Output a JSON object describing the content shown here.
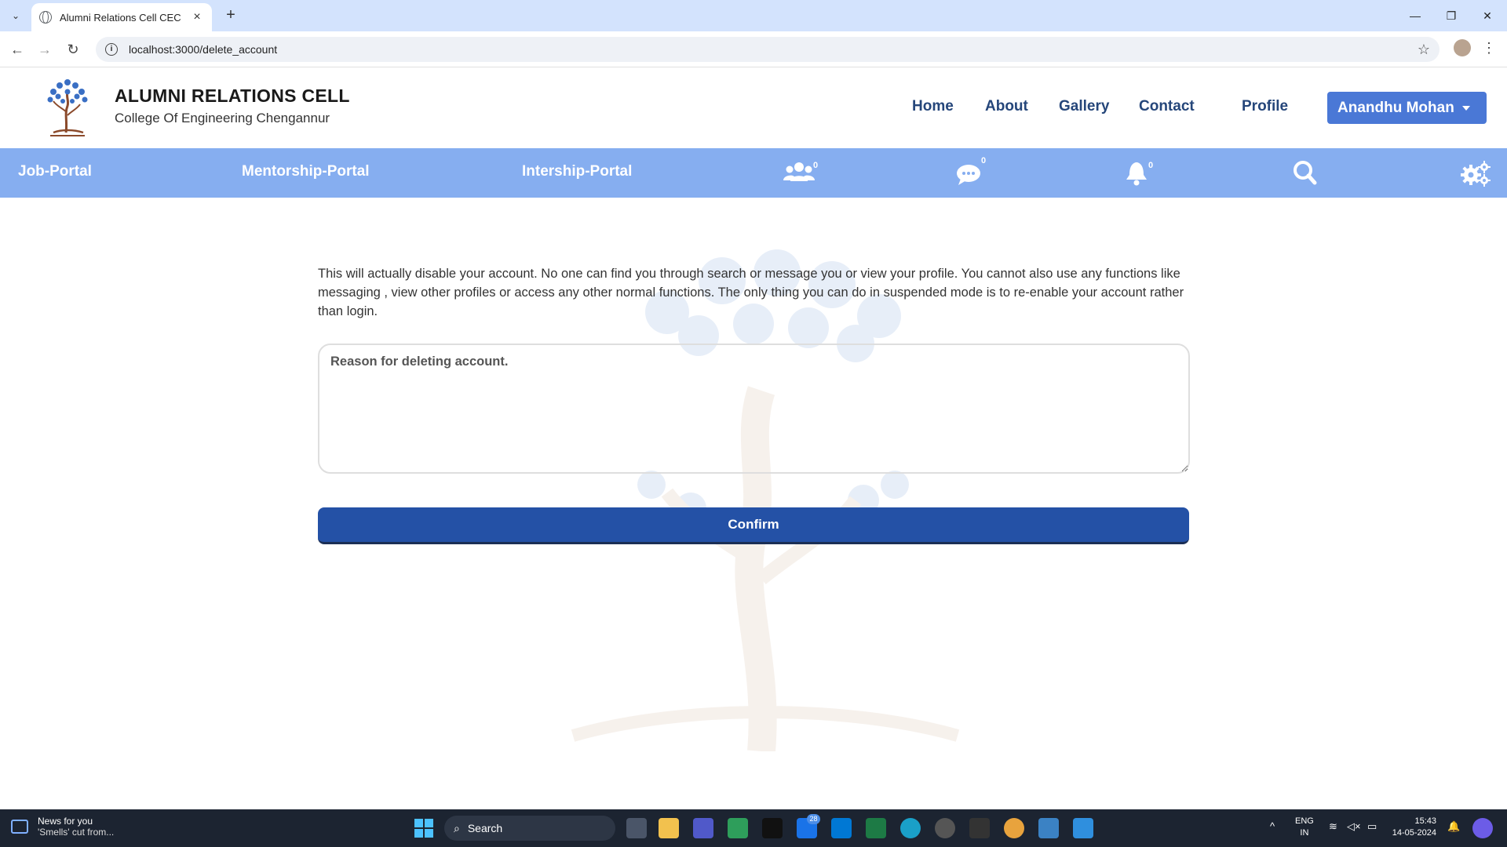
{
  "browser": {
    "tab_title": "Alumni Relations Cell CEC",
    "url": "localhost:3000/delete_account"
  },
  "header": {
    "brand_title": "ALUMNI RELATIONS CELL",
    "brand_subtitle": "College Of Engineering Chengannur",
    "nav": [
      "Home",
      "About",
      "Gallery",
      "Contact",
      "Profile"
    ],
    "user_name": "Anandhu Mohan"
  },
  "subnav": {
    "links": [
      "Job-Portal",
      "Mentorship-Portal",
      "Intership-Portal"
    ],
    "connections_count": "0",
    "messages_count": "0",
    "notifications_count": "0"
  },
  "main": {
    "notice": "This will actually disable your account. No one can find you through search or message you or view your profile. You cannot also use any functions like messaging , view other profiles or access any other normal functions. The only thing you can do in suspended mode is to re-enable your account rather than login.",
    "reason_placeholder": "Reason for deleting account.",
    "reason_value": "",
    "confirm_label": "Confirm"
  },
  "taskbar": {
    "news_title": "News for you",
    "news_sub": "'Smells' cut from...",
    "search_label": "Search",
    "mail_badge": "28",
    "lang_line1": "ENG",
    "lang_line2": "IN",
    "time": "15:43",
    "date": "14-05-2024"
  },
  "colors": {
    "brand_nav": "#25467a",
    "user_button": "#4a78d6",
    "subnav_bg": "#86aef0",
    "confirm_bg": "#2451a6"
  }
}
